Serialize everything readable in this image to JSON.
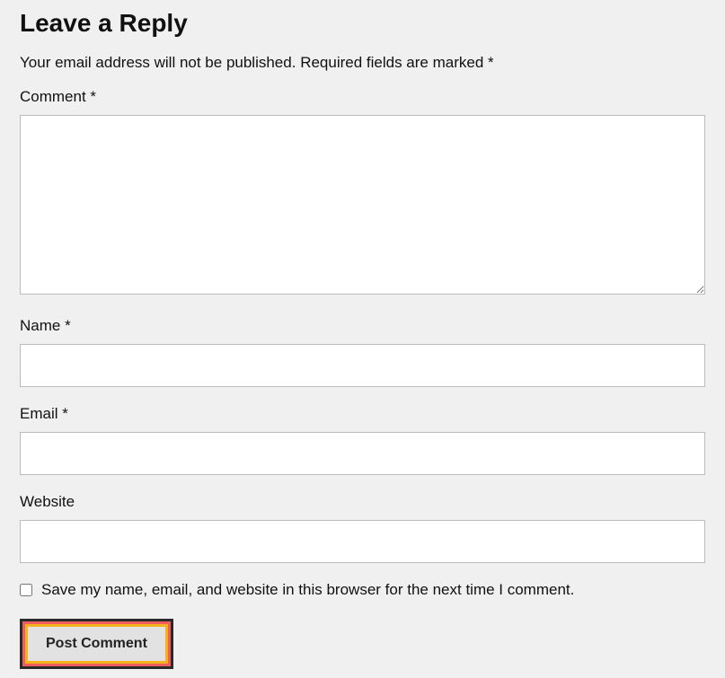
{
  "title": "Leave a Reply",
  "notice_part1": "Your email address will not be published.",
  "notice_part2": "Required fields are marked *",
  "fields": {
    "comment": {
      "label": "Comment ",
      "required": "*"
    },
    "name": {
      "label": "Name ",
      "required": "*"
    },
    "email": {
      "label": "Email ",
      "required": "*"
    },
    "website": {
      "label": "Website"
    }
  },
  "checkbox_label": "Save my name, email, and website in this browser for the next time I comment.",
  "submit_label": "Post Comment"
}
